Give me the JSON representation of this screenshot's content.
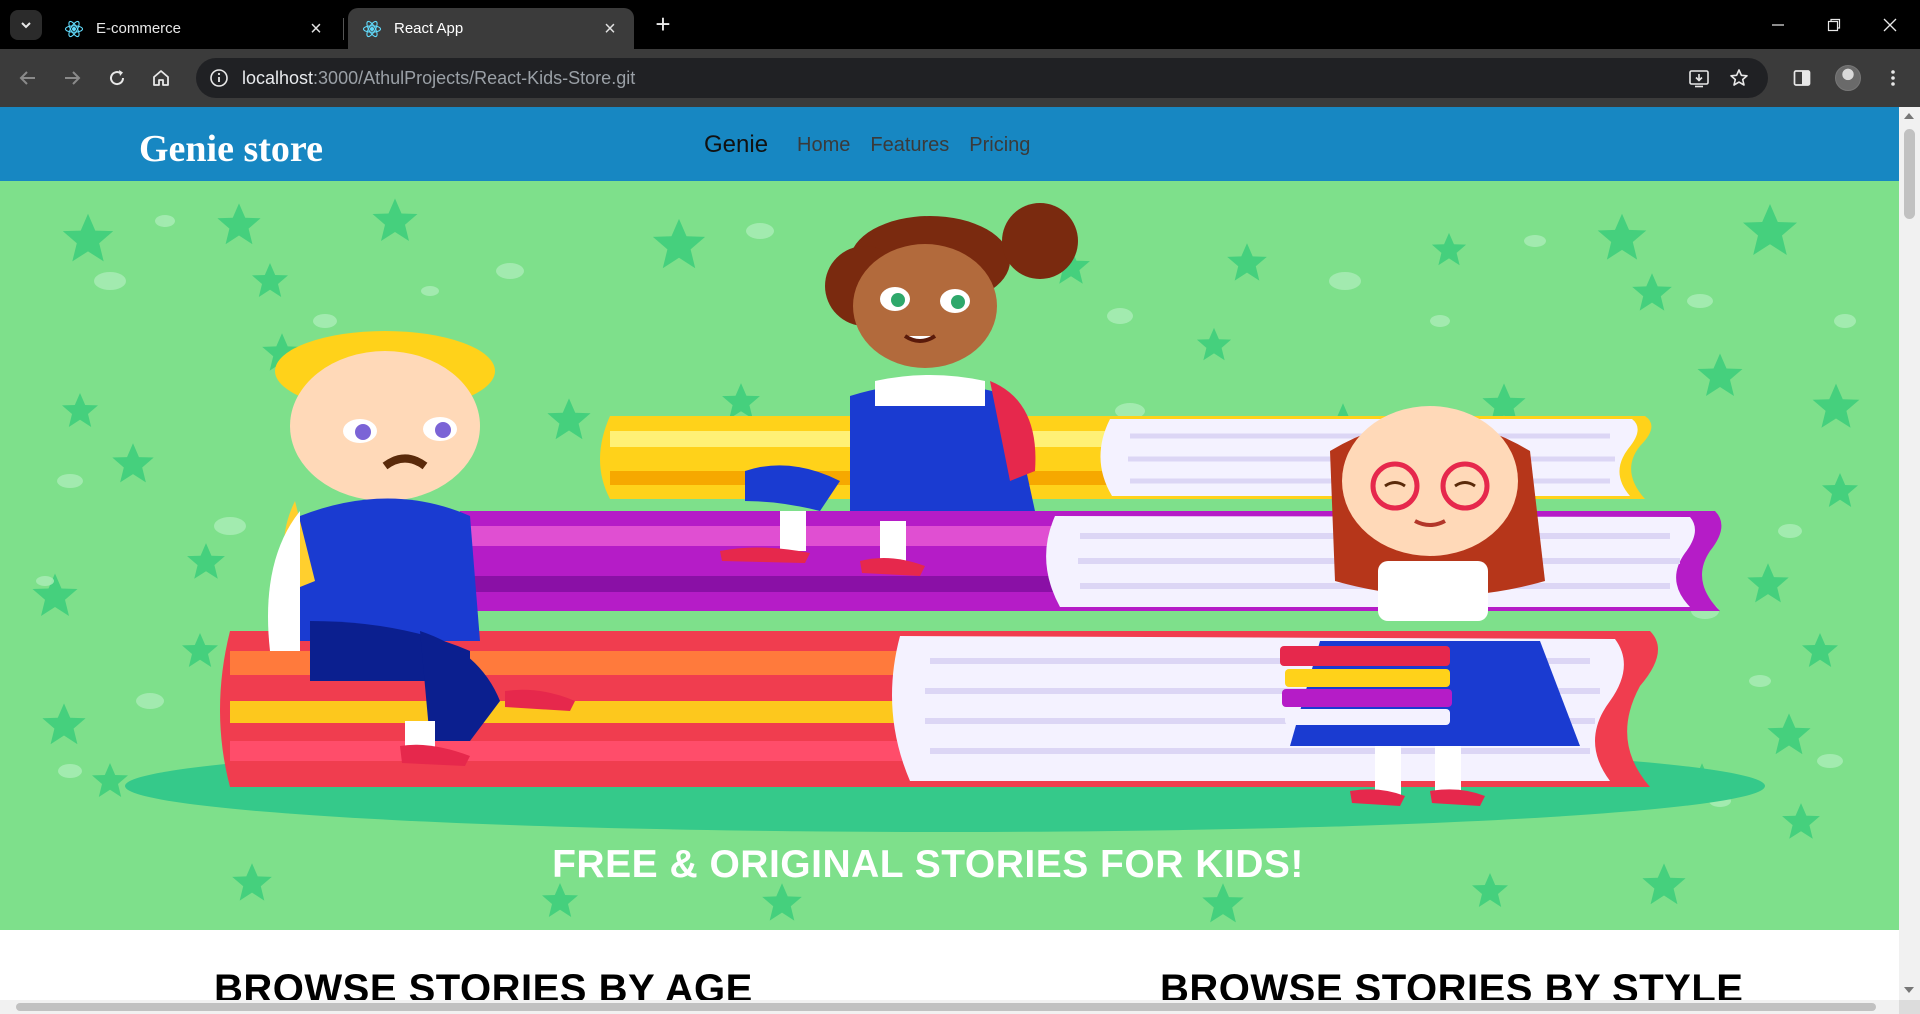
{
  "browser": {
    "tabs": [
      {
        "title": "E-commerce",
        "icon": "react-icon",
        "active": false
      },
      {
        "title": "React App",
        "icon": "react-icon",
        "active": true
      }
    ],
    "url_host": "localhost",
    "url_rest": ":3000/AthulProjects/React-Kids-Store.git"
  },
  "site": {
    "brand": "Genie store",
    "nav": {
      "genie": "Genie",
      "links": [
        "Home",
        "Features",
        "Pricing"
      ]
    },
    "hero": {
      "caption": "FREE & ORIGINAL STORIES FOR KIDS!"
    },
    "sections": {
      "age_heading": "BROWSE STORIES BY AGE",
      "style_heading": "BROWSE STORIES BY STYLE"
    }
  },
  "colors": {
    "nav_bg": "#1787c2",
    "hero_bg": "#7ee08b"
  }
}
